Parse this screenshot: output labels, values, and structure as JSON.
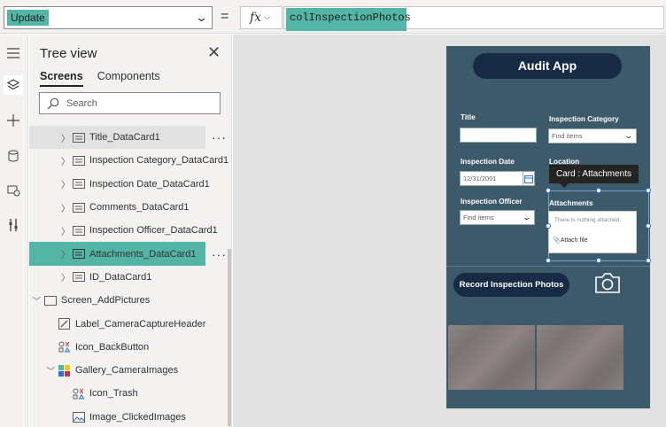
{
  "formula_bar": {
    "property": "Update",
    "fx_label": "fx",
    "formula": "colInspectionPhotos",
    "equals": "="
  },
  "tree": {
    "title": "Tree view",
    "tabs": [
      "Screens",
      "Components"
    ],
    "search_placeholder": "Search",
    "items": [
      {
        "label": "Title_DataCard1"
      },
      {
        "label": "Inspection Category_DataCard1"
      },
      {
        "label": "Inspection Date_DataCard1"
      },
      {
        "label": "Comments_DataCard1"
      },
      {
        "label": "Inspection Officer_DataCard1"
      },
      {
        "label": "Attachments_DataCard1"
      },
      {
        "label": "ID_DataCard1"
      },
      {
        "label": "Screen_AddPictures"
      },
      {
        "label": "Label_CameraCaptureHeader"
      },
      {
        "label": "Icon_BackButton"
      },
      {
        "label": "Gallery_CameraImages"
      },
      {
        "label": "Icon_Trash"
      },
      {
        "label": "Image_ClickedImages"
      }
    ]
  },
  "app": {
    "title": "Audit App",
    "title_label": "Title",
    "category_label": "Inspection Category",
    "category_placeholder": "Find items",
    "date_label": "Inspection Date",
    "date_value": "12/31/2001",
    "location_label": "Location",
    "officer_label": "Inspection Officer",
    "officer_placeholder": "Find items",
    "attachments_label": "Attachments",
    "attachments_empty": "There is nothing attached.",
    "attach_file": "Attach file",
    "tooltip": "Card : Attachments",
    "record_button": "Record Inspection Photos"
  },
  "colors": {
    "accent": "#53b5a5",
    "app_bg": "#3d5a6b",
    "button_bg": "#172b45"
  }
}
